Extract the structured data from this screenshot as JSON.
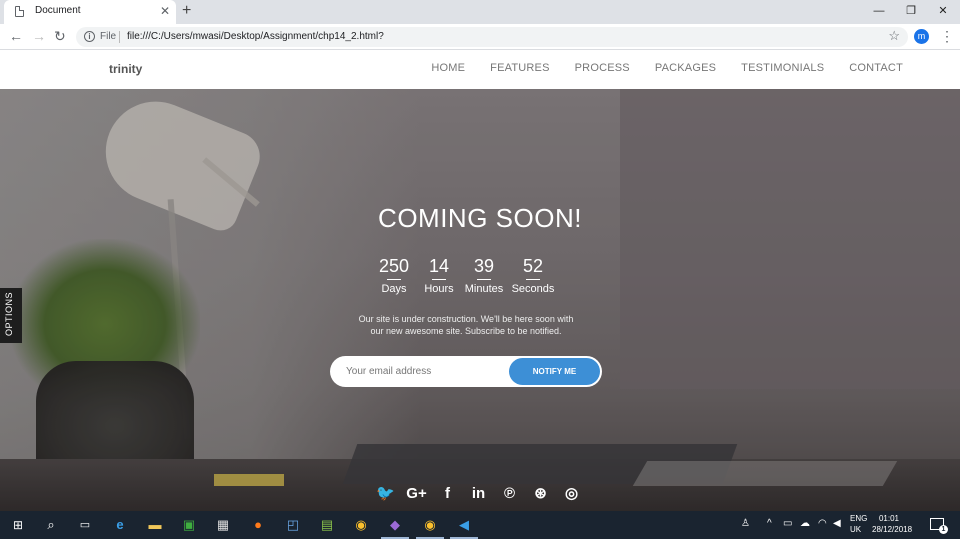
{
  "browser": {
    "tab_title": "Document",
    "tab_close": "✕",
    "new_tab": "+",
    "file_label": "File",
    "url": "file:///C:/Users/mwasi/Desktop/Assignment/chp14_2.html?",
    "avatar_letter": "m",
    "window_controls": [
      "—",
      "❐",
      "✕"
    ]
  },
  "site": {
    "logo": "trinity",
    "nav": [
      "HOME",
      "FEATURES",
      "PROCESS",
      "PACKAGES",
      "TESTIMONIALS",
      "CONTACT"
    ],
    "options_tab": "OPTIONS",
    "headline": "COMING SOON!",
    "countdown": [
      {
        "value": "250",
        "label": "Days"
      },
      {
        "value": "14",
        "label": "Hours"
      },
      {
        "value": "39",
        "label": "Minutes"
      },
      {
        "value": "52",
        "label": "Seconds"
      }
    ],
    "tagline": "Our site is under construction. We'll be here soon with our new awesome site. Subscribe to be notified.",
    "email_placeholder": "Your email address",
    "notify_label": "NOTIFY ME",
    "social_icons": [
      "twitter-icon",
      "google-plus-icon",
      "facebook-icon",
      "linkedin-icon",
      "pinterest-icon",
      "dribbble-icon",
      "instagram-icon"
    ],
    "social_glyphs": [
      "🐦",
      "G+",
      "f",
      "in",
      "℗",
      "⊛",
      "◎"
    ],
    "accent_color": "#3d8fd6"
  },
  "taskbar": {
    "icons": [
      "windows-start-icon",
      "search-icon",
      "task-view-icon",
      "edge-icon",
      "file-explorer-icon",
      "excel-like-icon",
      "store-icon",
      "firefox-icon",
      "photos-icon",
      "notepad-icon",
      "chrome-icon",
      "visual-studio-icon",
      "chrome-icon",
      "vscode-icon"
    ],
    "language_top": "ENG",
    "language_bottom": "UK",
    "time": "01:01",
    "date": "28/12/2018",
    "notification_count": "1"
  }
}
